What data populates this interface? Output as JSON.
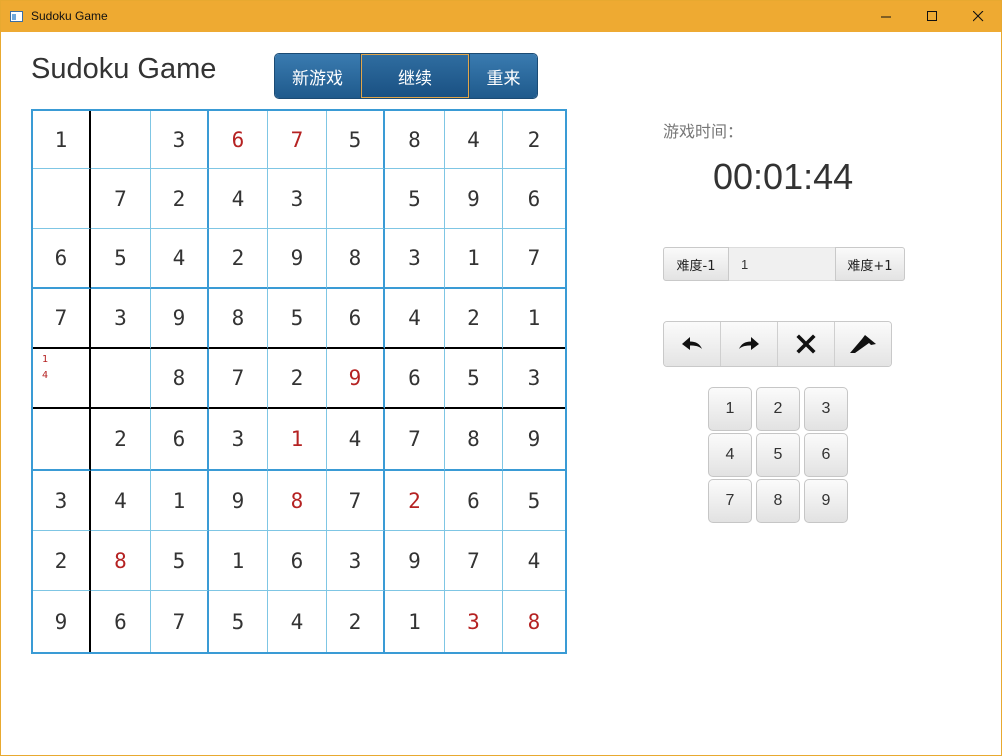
{
  "window": {
    "title": "Sudoku Game",
    "controls": [
      "minimize-icon",
      "maximize-icon",
      "close-icon"
    ]
  },
  "app": {
    "heading": "Sudoku Game"
  },
  "actions": {
    "new_game": "新游戏",
    "continue": "继续",
    "restart": "重来"
  },
  "board": {
    "rows": [
      [
        "1",
        "",
        "3",
        "6",
        "7",
        "5",
        "8",
        "4",
        "2"
      ],
      [
        "",
        "7",
        "2",
        "4",
        "3",
        "",
        "5",
        "9",
        "6"
      ],
      [
        "6",
        "5",
        "4",
        "2",
        "9",
        "8",
        "3",
        "1",
        "7"
      ],
      [
        "7",
        "3",
        "9",
        "8",
        "5",
        "6",
        "4",
        "2",
        "1"
      ],
      [
        "",
        "",
        "8",
        "7",
        "2",
        "9",
        "6",
        "5",
        "3"
      ],
      [
        "",
        "2",
        "6",
        "3",
        "1",
        "4",
        "7",
        "8",
        "9"
      ],
      [
        "3",
        "4",
        "1",
        "9",
        "8",
        "7",
        "2",
        "6",
        "5"
      ],
      [
        "2",
        "8",
        "5",
        "1",
        "6",
        "3",
        "9",
        "7",
        "4"
      ],
      [
        "9",
        "6",
        "7",
        "5",
        "4",
        "2",
        "1",
        "3",
        "8"
      ]
    ],
    "user_entered": [
      [
        0,
        3
      ],
      [
        0,
        4
      ],
      [
        4,
        5
      ],
      [
        5,
        4
      ],
      [
        6,
        4
      ],
      [
        6,
        6
      ],
      [
        7,
        1
      ],
      [
        8,
        7
      ],
      [
        8,
        8
      ]
    ],
    "notes": [
      {
        "row": 4,
        "col": 0,
        "values": [
          "1",
          "4"
        ]
      }
    ],
    "colors": {
      "given": "#333333",
      "entered": "#b52222",
      "box_border": "#3a9bd5",
      "cell_border": "#7fc6e4",
      "highlight": "#000000"
    }
  },
  "timer": {
    "label": "游戏时间：",
    "value": "00:01:44"
  },
  "difficulty": {
    "decrease_label": "难度-1",
    "value": "1",
    "increase_label": "难度+1"
  },
  "tools": [
    "undo-icon",
    "redo-icon",
    "clear-icon",
    "hint-icon"
  ],
  "numpad": [
    "1",
    "2",
    "3",
    "4",
    "5",
    "6",
    "7",
    "8",
    "9"
  ]
}
